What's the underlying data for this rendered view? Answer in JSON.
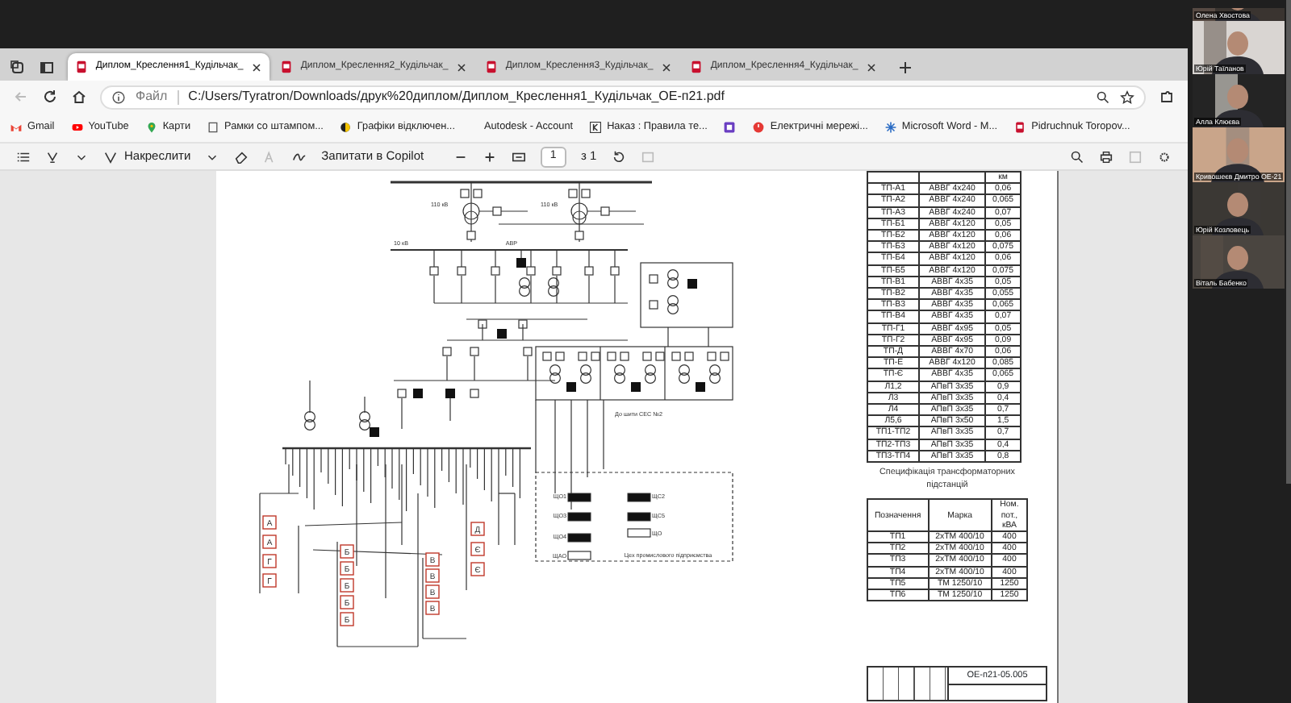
{
  "browser": {
    "tabs": [
      {
        "title": "Диплом_Креслення1_Кудільчак_",
        "selected": true
      },
      {
        "title": "Диплом_Креслення2_Кудільчак_",
        "selected": false
      },
      {
        "title": "Диплом_Креслення3_Кудільчак_",
        "selected": false
      },
      {
        "title": "Диплом_Креслення4_Кудільчак_",
        "selected": false
      }
    ],
    "address": {
      "scheme": "Файл",
      "url": "C:/Users/Tyratron/Downloads/друк%20диплом/Диплом_Креслення1_Кудільчак_ОЕ-п21.pdf"
    },
    "bookmarks": [
      {
        "kind": "gmail",
        "label": "Gmail"
      },
      {
        "kind": "youtube",
        "label": "YouTube"
      },
      {
        "kind": "pin",
        "label": "Карти"
      },
      {
        "kind": "page",
        "label": "Рамки со штампом..."
      },
      {
        "kind": "dot",
        "label": "Графіки відключен..."
      },
      {
        "kind": "none",
        "label": "Autodesk - Account"
      },
      {
        "kind": "k",
        "label": "Наказ : Правила те..."
      },
      {
        "kind": "square"
      },
      {
        "kind": "power",
        "label": "Електричні мережі..."
      },
      {
        "kind": "star",
        "label": "Microsoft Word - M..."
      },
      {
        "kind": "pdf",
        "label": "Pidruchnuk Toropov..."
      }
    ]
  },
  "pdf_toolbar": {
    "draw_label": "Накреслити",
    "copilot_label": "Запитати в Copilot",
    "page": "1",
    "page_total": "з 1"
  },
  "document": {
    "schematic_labels": [
      {
        "text": "110 кВ"
      },
      {
        "text": "110 кВ"
      },
      {
        "text": "10 кВ"
      },
      {
        "text": "АВР"
      },
      {
        "text": "До шити СЕС №2"
      },
      {
        "text": "ЩО1"
      },
      {
        "text": "ЩС2"
      },
      {
        "text": "ЩО3"
      },
      {
        "text": "ЩС5"
      },
      {
        "text": "ЩО4"
      },
      {
        "text": "ЩО"
      },
      {
        "text": "ЩАО"
      },
      {
        "text": "Цех промислового підприємства"
      }
    ],
    "consumer_tags": [
      {
        "letter": "А"
      },
      {
        "letter": "А"
      },
      {
        "letter": "Г"
      },
      {
        "letter": "Г"
      },
      {
        "letter": "Б"
      },
      {
        "letter": "Б"
      },
      {
        "letter": "Б"
      },
      {
        "letter": "Б"
      },
      {
        "letter": "Б"
      },
      {
        "letter": "В"
      },
      {
        "letter": "В"
      },
      {
        "letter": "В"
      },
      {
        "letter": "В"
      },
      {
        "letter": "Д"
      },
      {
        "letter": "Є"
      },
      {
        "letter": "Є"
      }
    ],
    "cable_table": {
      "unit": "км",
      "rows": [
        {
          "line": "ТП-А1",
          "cable": "АВВГ 4х240",
          "length": "0,06"
        },
        {
          "line": "ТП-А2",
          "cable": "АВВГ 4х240",
          "length": "0,065"
        },
        {
          "line": "ТП-А3",
          "cable": "АВВГ 4х240",
          "length": "0,07"
        },
        {
          "line": "ТП-Б1",
          "cable": "АВВГ 4х120",
          "length": "0,05"
        },
        {
          "line": "ТП-Б2",
          "cable": "АВВГ 4х120",
          "length": "0,06"
        },
        {
          "line": "ТП-Б3",
          "cable": "АВВГ 4х120",
          "length": "0,075"
        },
        {
          "line": "ТП-Б4",
          "cable": "АВВГ 4х120",
          "length": "0,06"
        },
        {
          "line": "ТП-Б5",
          "cable": "АВВГ 4х120",
          "length": "0,075"
        },
        {
          "line": "ТП-В1",
          "cable": "АВВГ 4х35",
          "length": "0,05"
        },
        {
          "line": "ТП-В2",
          "cable": "АВВГ 4х35",
          "length": "0,055"
        },
        {
          "line": "ТП-В3",
          "cable": "АВВГ 4х35",
          "length": "0,065"
        },
        {
          "line": "ТП-В4",
          "cable": "АВВГ 4х35",
          "length": "0,07"
        },
        {
          "line": "ТП-Г1",
          "cable": "АВВГ 4х95",
          "length": "0,05"
        },
        {
          "line": "ТП-Г2",
          "cable": "АВВГ 4х95",
          "length": "0,09"
        },
        {
          "line": "ТП-Д",
          "cable": "АВВГ 4х70",
          "length": "0,06"
        },
        {
          "line": "ТП-Е",
          "cable": "АВВГ 4х120",
          "length": "0,085"
        },
        {
          "line": "ТП-Є",
          "cable": "АВВГ 4х35",
          "length": "0,065"
        },
        {
          "line": "Л1,2",
          "cable": "АПвП 3х35",
          "length": "0,9"
        },
        {
          "line": "Л3",
          "cable": "АПвП 3х35",
          "length": "0,4"
        },
        {
          "line": "Л4",
          "cable": "АПвП 3х35",
          "length": "0,7"
        },
        {
          "line": "Л5,6",
          "cable": "АПвП 3х50",
          "length": "1,5"
        },
        {
          "line": "ТП1-ТП2",
          "cable": "АПвП 3х35",
          "length": "0,7"
        },
        {
          "line": "ТП2-ТП3",
          "cable": "АПвП 3х35",
          "length": "0,4"
        },
        {
          "line": "ТП3-ТП4",
          "cable": "АПвП 3х35",
          "length": "0,8"
        }
      ]
    },
    "spec_title": "Специфікація трансформаторних підстанцій",
    "spec_table": {
      "columns": [
        "Позначення",
        "Марка",
        "Ном. пот., кВА"
      ],
      "rows": [
        [
          "ТП1",
          "2хТМ 400/10",
          "400"
        ],
        [
          "ТП2",
          "2хТМ 400/10",
          "400"
        ],
        [
          "ТП3",
          "2хТМ 400/10",
          "400"
        ],
        [
          "ТП4",
          "2хТМ 400/10",
          "400"
        ],
        [
          "ТП5",
          "ТМ 1250/10",
          "1250"
        ],
        [
          "ТП6",
          "ТМ 1250/10",
          "1250"
        ]
      ]
    },
    "title_block": "ОЕ-п21-05.005"
  },
  "participants": [
    {
      "name": "Олена Хвостова"
    },
    {
      "name": "Юрій Таїланов"
    },
    {
      "name": "Алла Клюєва"
    },
    {
      "name": "Кривошеєв Дмитро ОЕ-21"
    },
    {
      "name": "Юрій Козловець"
    },
    {
      "name": "Віталь Бабенко"
    }
  ]
}
